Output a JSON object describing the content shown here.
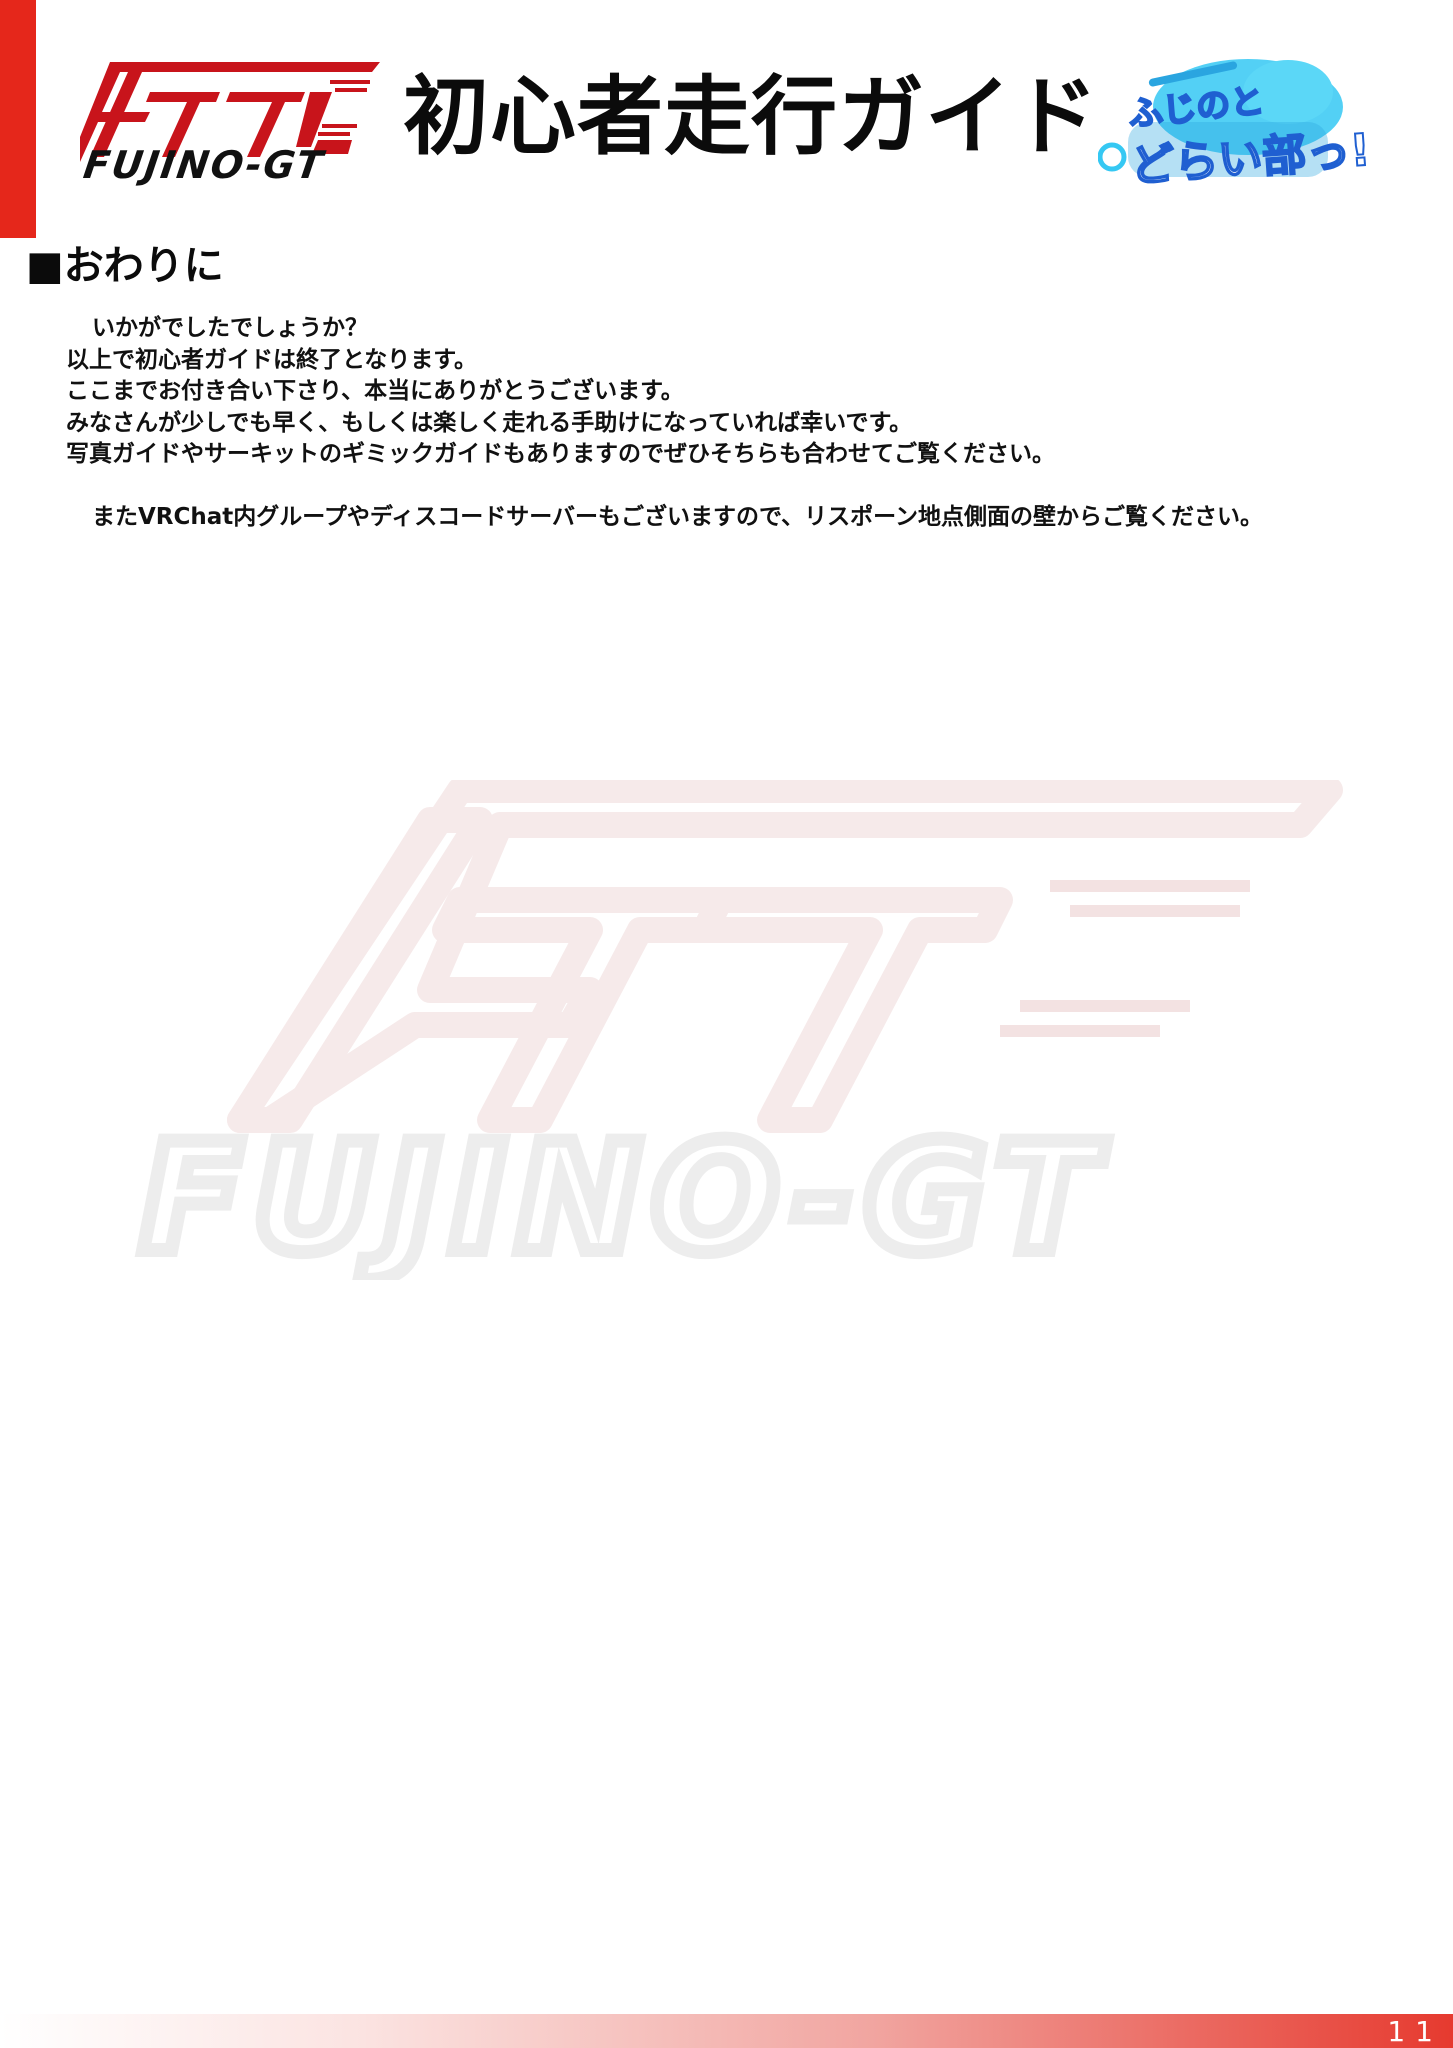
{
  "header": {
    "logo_text": "FUJINO-GT",
    "title": "初心者走行ガイド",
    "badge_line1": "ふじのと",
    "badge_line2": "どらい部っ!"
  },
  "section": {
    "title": "■おわりに",
    "lines": [
      "いかがでしたでしょうか？",
      "以上で初心者ガイドは終了となります。",
      "ここまでお付き合い下さり、本当にありがとうございます。",
      "みなさんが少しでも早く、もしくは楽しく走れる手助けになっていれば幸いです。",
      "写真ガイドやサーキットのギミックガイドもありますのでぜひそちらも合わせてご覧ください。",
      "またVRChat内グループやディスコードサーバーもございますので、リスポーン地点側面の壁からご覧ください。"
    ]
  },
  "watermark": {
    "text": "FUJINO-GT"
  },
  "footer": {
    "page_number": "11"
  },
  "colors": {
    "accent_red": "#e5271b",
    "badge_blue": "#1f5fd1",
    "badge_cyan": "#33c6f0"
  }
}
